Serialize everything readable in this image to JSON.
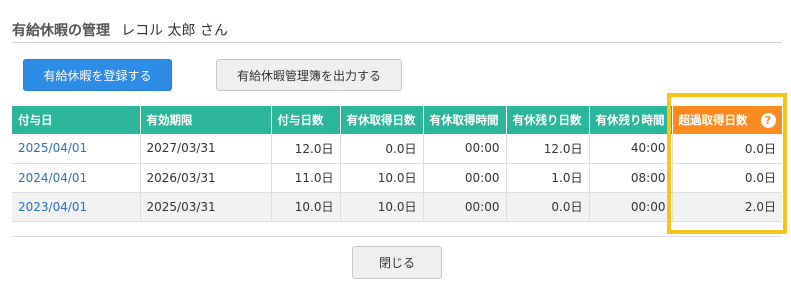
{
  "header": {
    "title": "有給休暇の管理",
    "user": "レコル 太郎 さん"
  },
  "actions": {
    "register_label": "有給休暇を登録する",
    "export_label": "有給休暇管理簿を出力する"
  },
  "table": {
    "columns": [
      "付与日",
      "有効期限",
      "付与日数",
      "有休取得日数",
      "有休取得時間",
      "有休残り日数",
      "有休残り時間",
      "超過取得日数"
    ],
    "rows": [
      [
        "2025/04/01",
        "2027/03/31",
        "12.0日",
        "0.0日",
        "00:00",
        "12.0日",
        "40:00",
        "0.0日"
      ],
      [
        "2024/04/01",
        "2026/03/31",
        "11.0日",
        "10.0日",
        "00:00",
        "1.0日",
        "08:00",
        "0.0日"
      ],
      [
        "2023/04/01",
        "2025/03/31",
        "10.0日",
        "10.0日",
        "00:00",
        "0.0日",
        "00:00",
        "2.0日"
      ]
    ]
  },
  "help_icon": {
    "name": "question-circle-icon",
    "glyph": "?"
  },
  "footer": {
    "close_label": "閉じる"
  },
  "colors": {
    "header_bg": "#2bb59a",
    "excess_header_bg": "#ff8a1f",
    "primary_button": "#2d8ce6",
    "highlight": "#f7c418",
    "link": "#2f6fc0"
  }
}
